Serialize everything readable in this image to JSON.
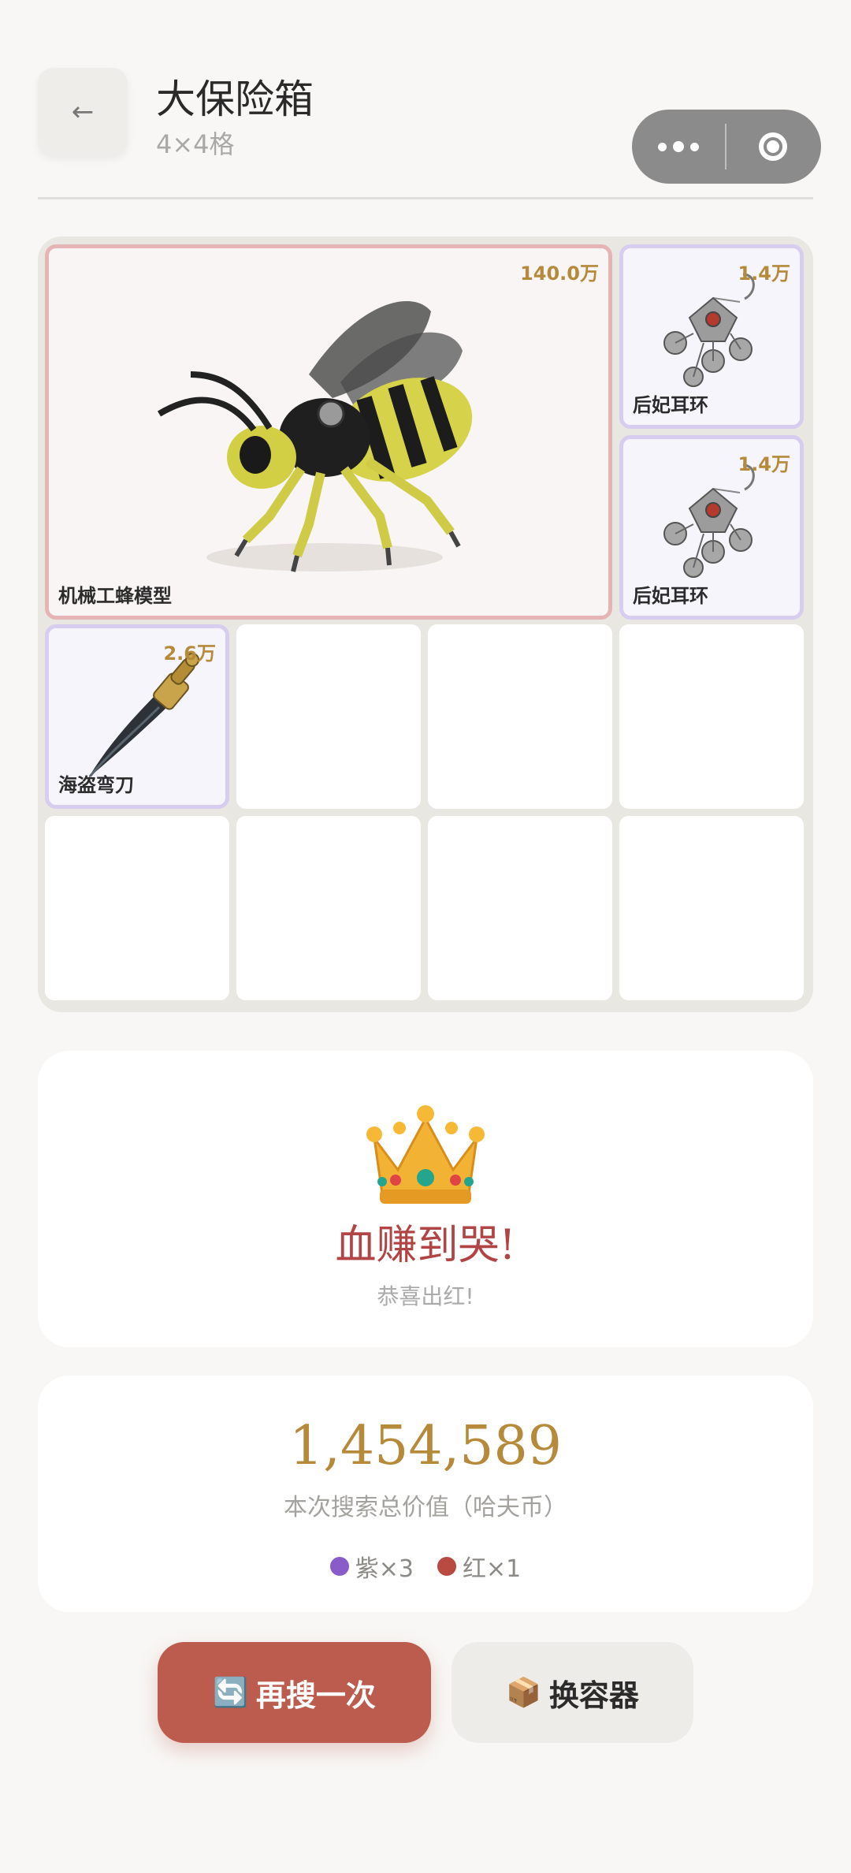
{
  "header": {
    "back_icon": "←",
    "title": "大保险箱",
    "subtitle": "4×4格"
  },
  "items": {
    "bee": {
      "name": "机械工蜂模型",
      "price": "140.0万",
      "rarity": "red"
    },
    "earring_1": {
      "name": "后妃耳环",
      "price": "1.4万",
      "rarity": "purple"
    },
    "earring_2": {
      "name": "后妃耳环",
      "price": "1.4万",
      "rarity": "purple"
    },
    "sabre": {
      "name": "海盗弯刀",
      "price": "2.6万",
      "rarity": "purple"
    }
  },
  "result": {
    "title": "血赚到哭!",
    "subtitle": "恭喜出红!"
  },
  "summary": {
    "total_value": "1,454,589",
    "label": "本次搜索总价值（哈夫币）",
    "counts": [
      {
        "label": "紫×3",
        "color": "#8a5cc9"
      },
      {
        "label": "红×1",
        "color": "#b84a42"
      }
    ]
  },
  "buttons": {
    "search_again_icon": "🔄",
    "search_again": "再搜一次",
    "switch_container_icon": "📦",
    "switch_container": "换容器"
  },
  "colors": {
    "accent_red": "#bb5c4e",
    "gold": "#b58a3a",
    "red_border": "#e5b5b5",
    "purple_border": "#d7cdee"
  }
}
